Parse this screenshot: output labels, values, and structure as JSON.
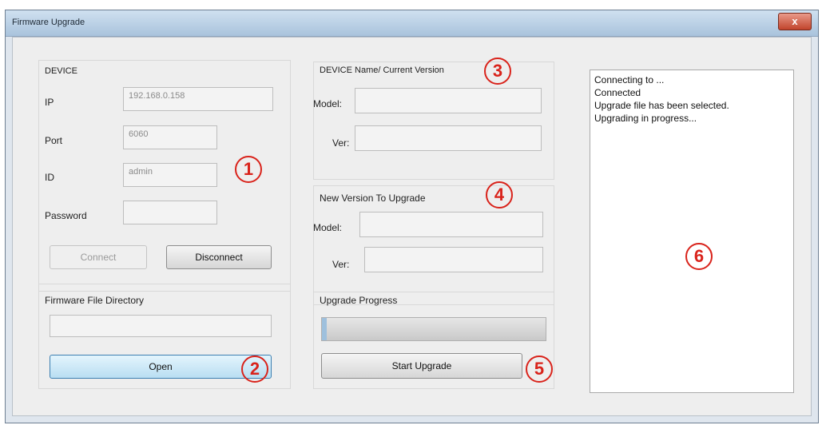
{
  "window": {
    "title": "Firmware Upgrade",
    "close_glyph": "x"
  },
  "device": {
    "group_label": "DEVICE",
    "ip_label": "IP",
    "ip_value": "192.168.0.158",
    "port_label": "Port",
    "port_value": "6060",
    "id_label": "ID",
    "id_value": "admin",
    "password_label": "Password",
    "password_value": "",
    "connect_label": "Connect",
    "disconnect_label": "Disconnect"
  },
  "firmware": {
    "label": "Firmware File Directory",
    "path_value": "",
    "open_label": "Open"
  },
  "current": {
    "label": "DEVICE Name/ Current Version",
    "model_label": "Model:",
    "model_value": "",
    "ver_label": "Ver:",
    "ver_value": ""
  },
  "new_version": {
    "label": "New Version To Upgrade",
    "model_label": "Model:",
    "model_value": "",
    "ver_label": "Ver:",
    "ver_value": ""
  },
  "upgrade": {
    "label": "Upgrade Progress",
    "progress": 0.02,
    "start_label": "Start Upgrade"
  },
  "log": {
    "lines": [
      "Connecting to ...",
      "Connected",
      "Upgrade file has been selected.",
      "Upgrading in progress..."
    ]
  },
  "annotations": [
    "1",
    "2",
    "3",
    "4",
    "5",
    "6"
  ],
  "colors": {
    "annotation": "#d9231b",
    "open_button": "#b9def2"
  }
}
